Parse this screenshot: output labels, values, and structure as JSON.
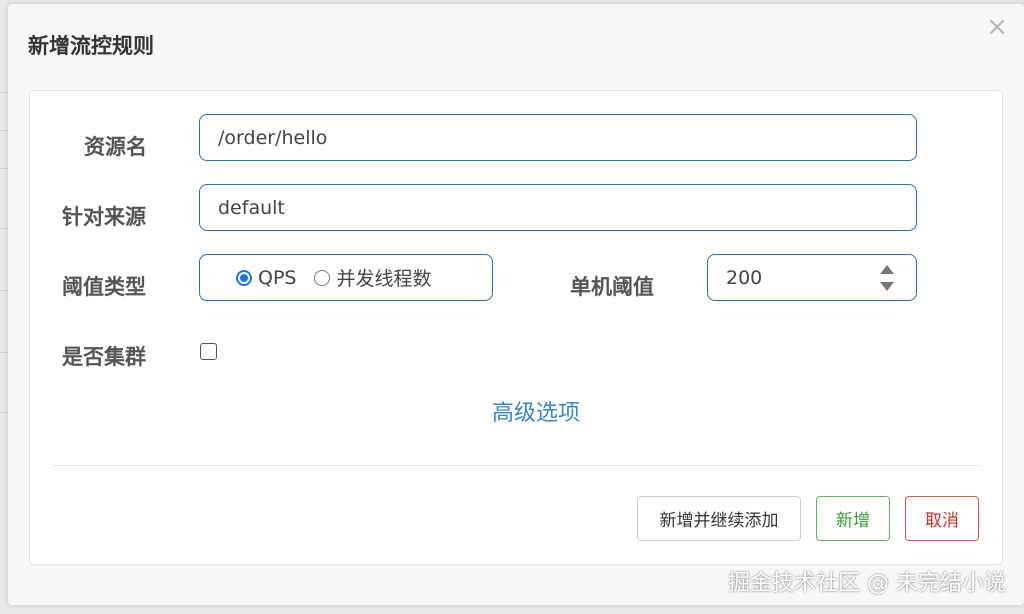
{
  "dialog": {
    "title": "新增流控规则",
    "close_label": "×"
  },
  "form": {
    "resource_name": {
      "label": "资源名",
      "value": "/order/hello"
    },
    "limit_app": {
      "label": "针对来源",
      "value": "default"
    },
    "threshold_type": {
      "label": "阈值类型",
      "options": [
        {
          "label": "QPS",
          "selected": true
        },
        {
          "label": "并发线程数",
          "selected": false
        }
      ]
    },
    "single_threshold": {
      "label": "单机阈值",
      "value": "200"
    },
    "cluster_mode": {
      "label": "是否集群",
      "checked": false
    },
    "advanced_link": "高级选项"
  },
  "footer": {
    "add_continue_label": "新增并继续添加",
    "add_label": "新增",
    "cancel_label": "取消",
    "colors": {
      "add": "#3a9a3a",
      "cancel": "#c9302c",
      "add_border": "#5cb85c",
      "cancel_border": "#d9534f"
    }
  },
  "watermark": "掘金技术社区 @ 未完结小说",
  "colors": {
    "accent": "#2d6fb0",
    "link": "#3a86c8"
  }
}
